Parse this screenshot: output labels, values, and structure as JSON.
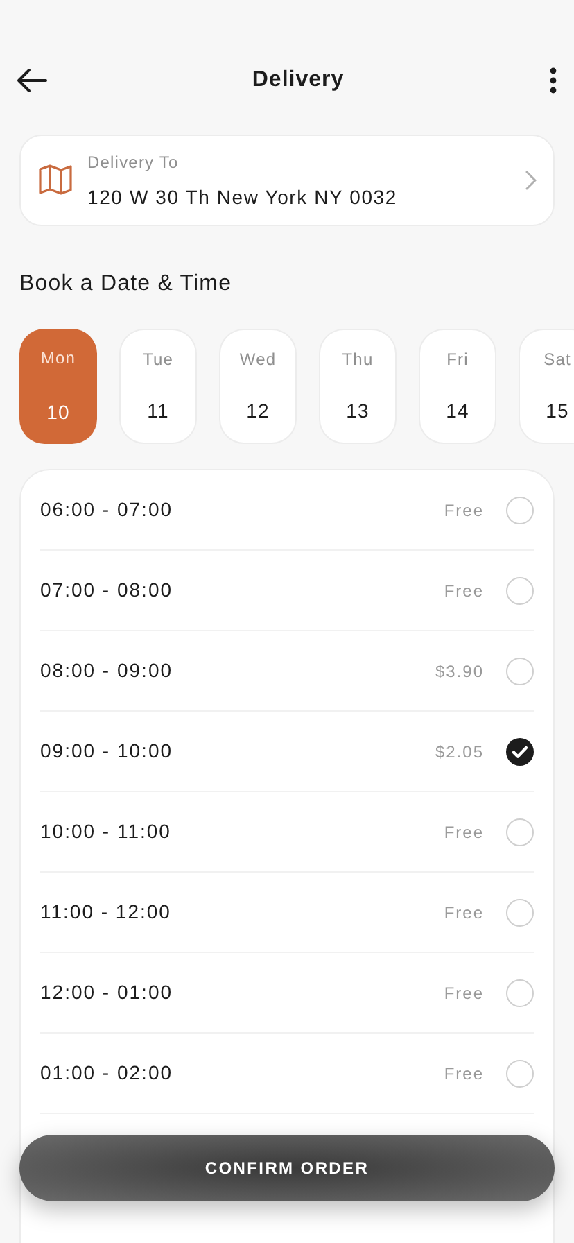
{
  "header": {
    "title": "Delivery"
  },
  "address": {
    "label": "Delivery To",
    "value": "120 W 30 Th New York NY 0032"
  },
  "section_title": "Book a Date & Time",
  "days": [
    {
      "weekday": "Mon",
      "date": "10",
      "selected": true
    },
    {
      "weekday": "Tue",
      "date": "11",
      "selected": false
    },
    {
      "weekday": "Wed",
      "date": "12",
      "selected": false
    },
    {
      "weekday": "Thu",
      "date": "13",
      "selected": false
    },
    {
      "weekday": "Fri",
      "date": "14",
      "selected": false
    },
    {
      "weekday": "Sat",
      "date": "15",
      "selected": false
    }
  ],
  "slots": [
    {
      "time": "06:00 - 07:00",
      "price": "Free",
      "selected": false
    },
    {
      "time": "07:00 - 08:00",
      "price": "Free",
      "selected": false
    },
    {
      "time": "08:00 - 09:00",
      "price": "$3.90",
      "selected": false
    },
    {
      "time": "09:00 - 10:00",
      "price": "$2.05",
      "selected": true
    },
    {
      "time": "10:00 - 11:00",
      "price": "Free",
      "selected": false
    },
    {
      "time": "11:00 - 12:00",
      "price": "Free",
      "selected": false
    },
    {
      "time": "12:00 - 01:00",
      "price": "Free",
      "selected": false
    },
    {
      "time": "01:00 - 02:00",
      "price": "Free",
      "selected": false
    }
  ],
  "confirm_button": "CONFIRM ORDER"
}
